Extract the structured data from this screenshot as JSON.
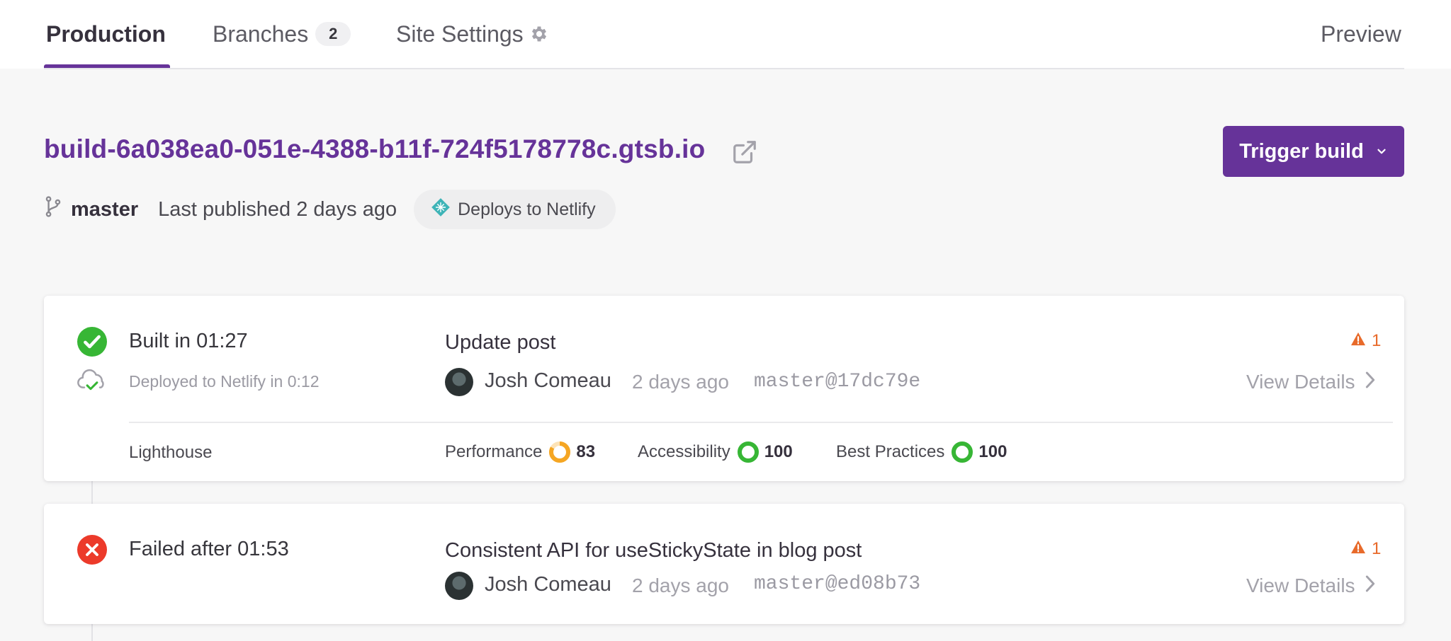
{
  "tabs": {
    "production": "Production",
    "branches": "Branches",
    "branches_count": "2",
    "site_settings": "Site Settings",
    "preview": "Preview"
  },
  "site": {
    "url": "build-6a038ea0-051e-4388-b11f-724f5178778c.gtsb.io",
    "trigger_label": "Trigger build",
    "branch": "master",
    "last_published": "Last published 2 days ago",
    "deploy_target": "Deploys to Netlify"
  },
  "builds": [
    {
      "status": "success",
      "status_text": "Built in 01:27",
      "deploy_text": "Deployed to Netlify in 0:12",
      "commit_message": "Update post",
      "author": "Josh Comeau",
      "time_ago": "2 days ago",
      "commit_ref": "master@17dc79e",
      "warnings": "1",
      "details_label": "View Details",
      "lighthouse": {
        "label": "Lighthouse",
        "scores": [
          {
            "name": "Performance",
            "value": "83",
            "color": "#f5a623"
          },
          {
            "name": "Accessibility",
            "value": "100",
            "color": "#37b635"
          },
          {
            "name": "Best Practices",
            "value": "100",
            "color": "#37b635"
          }
        ]
      }
    },
    {
      "status": "failed",
      "status_text": "Failed after 01:53",
      "commit_message": "Consistent API for useStickyState in blog post",
      "author": "Josh Comeau",
      "time_ago": "2 days ago",
      "commit_ref": "master@ed08b73",
      "warnings": "1",
      "details_label": "View Details"
    }
  ],
  "colors": {
    "brand": "#663399",
    "success": "#37b635",
    "error": "#ec1818",
    "warning": "#e86a2a"
  },
  "icons": [
    "gear-icon",
    "external-link-icon",
    "chevron-down-icon",
    "git-branch-icon",
    "netlify-icon",
    "check-circle-icon",
    "cloud-check-icon",
    "error-circle-icon",
    "warning-icon",
    "chevron-right-icon",
    "avatar"
  ]
}
